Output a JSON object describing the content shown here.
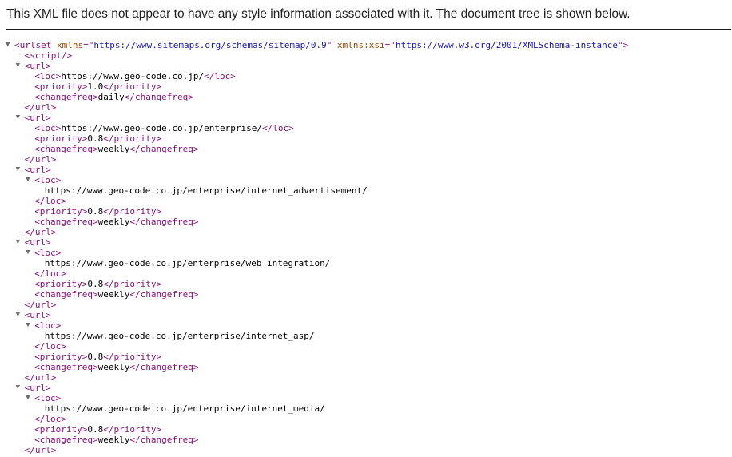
{
  "banner": {
    "message": "This XML file does not appear to have any style information associated with it. The document tree is shown below."
  },
  "icons": {
    "expanded_arrow": "▼",
    "arrow_name": "collapse-triangle-icon"
  },
  "colors": {
    "tag": "#881280",
    "attribute_name": "#994500",
    "attribute_value": "#1a1aa6",
    "text": "#000000",
    "arrow": "#6e6e6e"
  },
  "tree": [
    {
      "depth": 0,
      "arrow": true,
      "parts": [
        {
          "t": "tag",
          "v": "<urlset "
        },
        {
          "t": "attr-name",
          "v": "xmlns"
        },
        {
          "t": "tag",
          "v": "=\""
        },
        {
          "t": "attr-value",
          "v": "https://www.sitemaps.org/schemas/sitemap/0.9"
        },
        {
          "t": "tag",
          "v": "\" "
        },
        {
          "t": "attr-name",
          "v": "xmlns:xsi"
        },
        {
          "t": "tag",
          "v": "=\""
        },
        {
          "t": "attr-value",
          "v": "https://www.w3.org/2001/XMLSchema-instance"
        },
        {
          "t": "tag",
          "v": "\">"
        }
      ]
    },
    {
      "depth": 1,
      "arrow": false,
      "parts": [
        {
          "t": "tag",
          "v": "<script/>"
        }
      ]
    },
    {
      "depth": 1,
      "arrow": true,
      "parts": [
        {
          "t": "tag",
          "v": "<url>"
        }
      ]
    },
    {
      "depth": 2,
      "arrow": false,
      "parts": [
        {
          "t": "tag",
          "v": "<loc>"
        },
        {
          "t": "text",
          "v": "https://www.geo-code.co.jp/"
        },
        {
          "t": "tag",
          "v": "</loc>"
        }
      ]
    },
    {
      "depth": 2,
      "arrow": false,
      "parts": [
        {
          "t": "tag",
          "v": "<priority>"
        },
        {
          "t": "text",
          "v": "1.0"
        },
        {
          "t": "tag",
          "v": "</priority>"
        }
      ]
    },
    {
      "depth": 2,
      "arrow": false,
      "parts": [
        {
          "t": "tag",
          "v": "<changefreq>"
        },
        {
          "t": "text",
          "v": "daily"
        },
        {
          "t": "tag",
          "v": "</changefreq>"
        }
      ]
    },
    {
      "depth": 1,
      "arrow": false,
      "parts": [
        {
          "t": "tag",
          "v": "</url>"
        }
      ]
    },
    {
      "depth": 1,
      "arrow": true,
      "parts": [
        {
          "t": "tag",
          "v": "<url>"
        }
      ]
    },
    {
      "depth": 2,
      "arrow": false,
      "parts": [
        {
          "t": "tag",
          "v": "<loc>"
        },
        {
          "t": "text",
          "v": "https://www.geo-code.co.jp/enterprise/"
        },
        {
          "t": "tag",
          "v": "</loc>"
        }
      ]
    },
    {
      "depth": 2,
      "arrow": false,
      "parts": [
        {
          "t": "tag",
          "v": "<priority>"
        },
        {
          "t": "text",
          "v": "0.8"
        },
        {
          "t": "tag",
          "v": "</priority>"
        }
      ]
    },
    {
      "depth": 2,
      "arrow": false,
      "parts": [
        {
          "t": "tag",
          "v": "<changefreq>"
        },
        {
          "t": "text",
          "v": "weekly"
        },
        {
          "t": "tag",
          "v": "</changefreq>"
        }
      ]
    },
    {
      "depth": 1,
      "arrow": false,
      "parts": [
        {
          "t": "tag",
          "v": "</url>"
        }
      ]
    },
    {
      "depth": 1,
      "arrow": true,
      "parts": [
        {
          "t": "tag",
          "v": "<url>"
        }
      ]
    },
    {
      "depth": 2,
      "arrow": true,
      "parts": [
        {
          "t": "tag",
          "v": "<loc>"
        }
      ]
    },
    {
      "depth": 3,
      "arrow": false,
      "parts": [
        {
          "t": "text",
          "v": "https://www.geo-code.co.jp/enterprise/internet_advertisement/"
        }
      ]
    },
    {
      "depth": 2,
      "arrow": false,
      "parts": [
        {
          "t": "tag",
          "v": "</loc>"
        }
      ]
    },
    {
      "depth": 2,
      "arrow": false,
      "parts": [
        {
          "t": "tag",
          "v": "<priority>"
        },
        {
          "t": "text",
          "v": "0.8"
        },
        {
          "t": "tag",
          "v": "</priority>"
        }
      ]
    },
    {
      "depth": 2,
      "arrow": false,
      "parts": [
        {
          "t": "tag",
          "v": "<changefreq>"
        },
        {
          "t": "text",
          "v": "weekly"
        },
        {
          "t": "tag",
          "v": "</changefreq>"
        }
      ]
    },
    {
      "depth": 1,
      "arrow": false,
      "parts": [
        {
          "t": "tag",
          "v": "</url>"
        }
      ]
    },
    {
      "depth": 1,
      "arrow": true,
      "parts": [
        {
          "t": "tag",
          "v": "<url>"
        }
      ]
    },
    {
      "depth": 2,
      "arrow": true,
      "parts": [
        {
          "t": "tag",
          "v": "<loc>"
        }
      ]
    },
    {
      "depth": 3,
      "arrow": false,
      "parts": [
        {
          "t": "text",
          "v": "https://www.geo-code.co.jp/enterprise/web_integration/"
        }
      ]
    },
    {
      "depth": 2,
      "arrow": false,
      "parts": [
        {
          "t": "tag",
          "v": "</loc>"
        }
      ]
    },
    {
      "depth": 2,
      "arrow": false,
      "parts": [
        {
          "t": "tag",
          "v": "<priority>"
        },
        {
          "t": "text",
          "v": "0.8"
        },
        {
          "t": "tag",
          "v": "</priority>"
        }
      ]
    },
    {
      "depth": 2,
      "arrow": false,
      "parts": [
        {
          "t": "tag",
          "v": "<changefreq>"
        },
        {
          "t": "text",
          "v": "weekly"
        },
        {
          "t": "tag",
          "v": "</changefreq>"
        }
      ]
    },
    {
      "depth": 1,
      "arrow": false,
      "parts": [
        {
          "t": "tag",
          "v": "</url>"
        }
      ]
    },
    {
      "depth": 1,
      "arrow": true,
      "parts": [
        {
          "t": "tag",
          "v": "<url>"
        }
      ]
    },
    {
      "depth": 2,
      "arrow": true,
      "parts": [
        {
          "t": "tag",
          "v": "<loc>"
        }
      ]
    },
    {
      "depth": 3,
      "arrow": false,
      "parts": [
        {
          "t": "text",
          "v": "https://www.geo-code.co.jp/enterprise/internet_asp/"
        }
      ]
    },
    {
      "depth": 2,
      "arrow": false,
      "parts": [
        {
          "t": "tag",
          "v": "</loc>"
        }
      ]
    },
    {
      "depth": 2,
      "arrow": false,
      "parts": [
        {
          "t": "tag",
          "v": "<priority>"
        },
        {
          "t": "text",
          "v": "0.8"
        },
        {
          "t": "tag",
          "v": "</priority>"
        }
      ]
    },
    {
      "depth": 2,
      "arrow": false,
      "parts": [
        {
          "t": "tag",
          "v": "<changefreq>"
        },
        {
          "t": "text",
          "v": "weekly"
        },
        {
          "t": "tag",
          "v": "</changefreq>"
        }
      ]
    },
    {
      "depth": 1,
      "arrow": false,
      "parts": [
        {
          "t": "tag",
          "v": "</url>"
        }
      ]
    },
    {
      "depth": 1,
      "arrow": true,
      "parts": [
        {
          "t": "tag",
          "v": "<url>"
        }
      ]
    },
    {
      "depth": 2,
      "arrow": true,
      "parts": [
        {
          "t": "tag",
          "v": "<loc>"
        }
      ]
    },
    {
      "depth": 3,
      "arrow": false,
      "parts": [
        {
          "t": "text",
          "v": "https://www.geo-code.co.jp/enterprise/internet_media/"
        }
      ]
    },
    {
      "depth": 2,
      "arrow": false,
      "parts": [
        {
          "t": "tag",
          "v": "</loc>"
        }
      ]
    },
    {
      "depth": 2,
      "arrow": false,
      "parts": [
        {
          "t": "tag",
          "v": "<priority>"
        },
        {
          "t": "text",
          "v": "0.8"
        },
        {
          "t": "tag",
          "v": "</priority>"
        }
      ]
    },
    {
      "depth": 2,
      "arrow": false,
      "parts": [
        {
          "t": "tag",
          "v": "<changefreq>"
        },
        {
          "t": "text",
          "v": "weekly"
        },
        {
          "t": "tag",
          "v": "</changefreq>"
        }
      ]
    },
    {
      "depth": 1,
      "arrow": false,
      "parts": [
        {
          "t": "tag",
          "v": "</url>"
        }
      ]
    }
  ]
}
